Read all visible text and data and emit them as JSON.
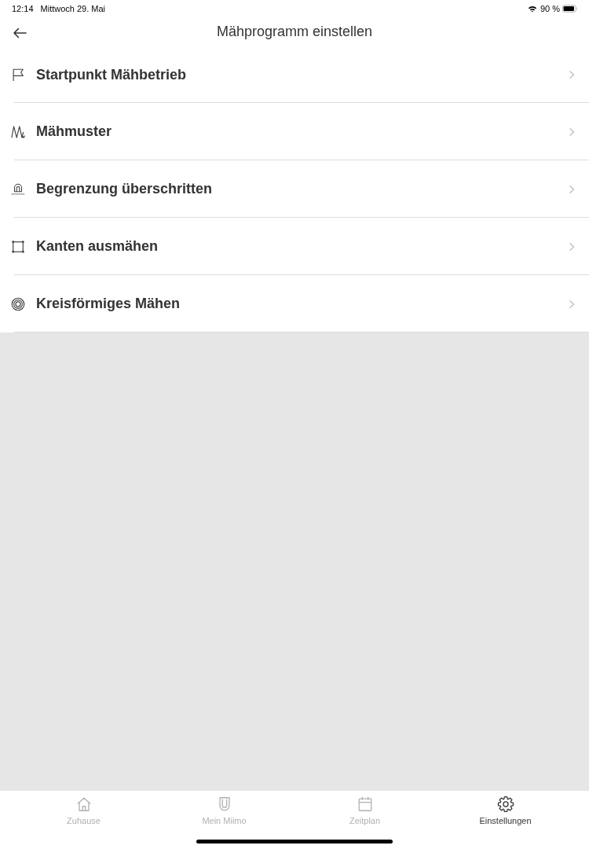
{
  "status_bar": {
    "time": "12:14",
    "date": "Mittwoch 29. Mai",
    "battery": "90 %"
  },
  "header": {
    "title": "Mähprogramm einstellen"
  },
  "menu": [
    {
      "kind": "start",
      "label": "Startpunkt Mähbetrieb"
    },
    {
      "kind": "pattern",
      "label": "Mähmuster"
    },
    {
      "kind": "boundary",
      "label": "Begrenzung überschritten"
    },
    {
      "kind": "edges",
      "label": "Kanten ausmähen"
    },
    {
      "kind": "spiral",
      "label": "Kreisförmiges Mähen"
    }
  ],
  "tab_bar": [
    {
      "kind": "home",
      "label": "Zuhause",
      "selected": false
    },
    {
      "kind": "mower",
      "label": "Mein Miimo",
      "selected": false
    },
    {
      "kind": "calendar",
      "label": "Zeitplan",
      "selected": false
    },
    {
      "kind": "settings",
      "label": "Einstellungen",
      "selected": true
    }
  ]
}
